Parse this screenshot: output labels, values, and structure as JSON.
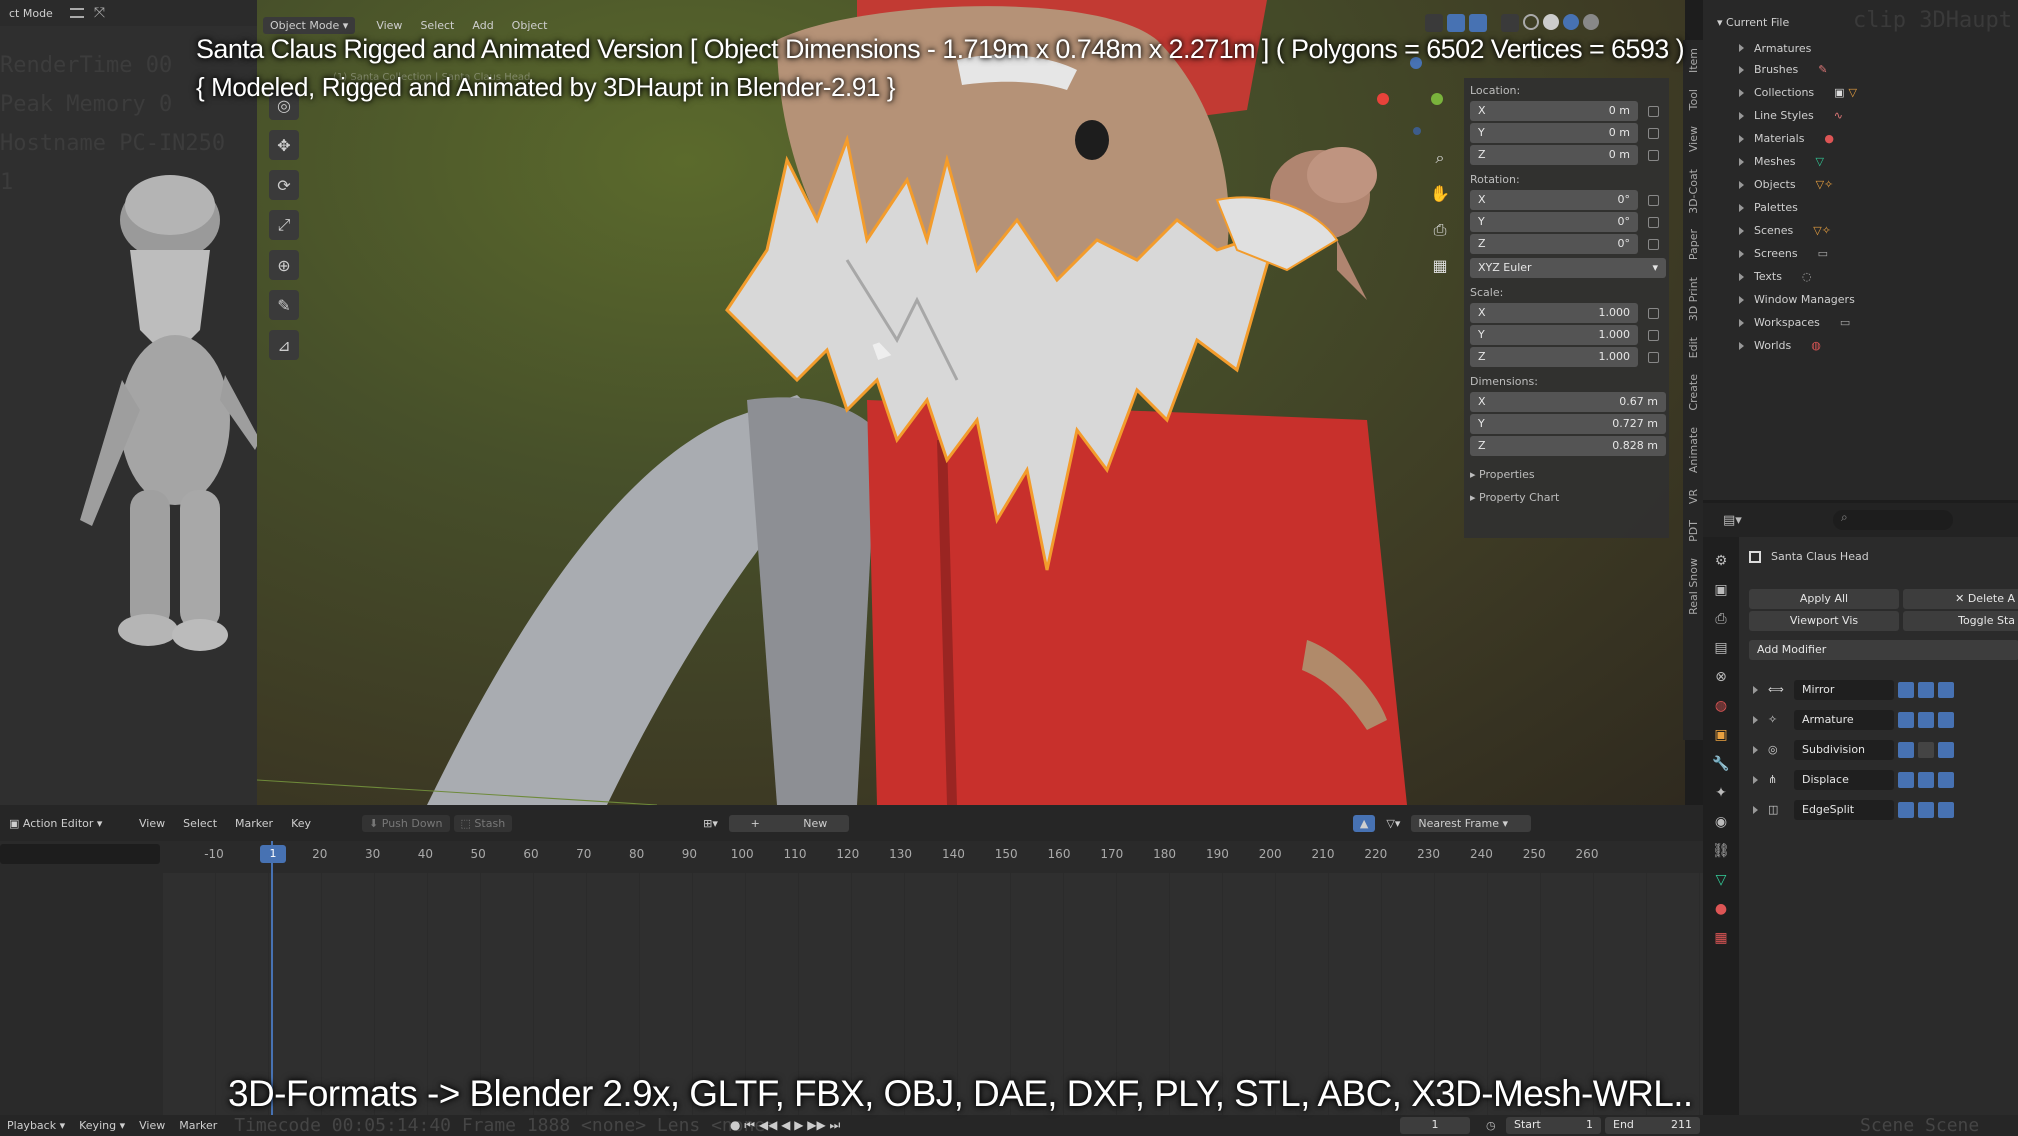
{
  "overlay": {
    "title_line1": "Santa Claus Rigged and Animated Version [ Object Dimensions -  1.719m x 0.748m x 2.271m ] ( Polygons = 6502  Vertices = 6593 )",
    "title_line2": "{ Modeled, Rigged and Animated by 3DHaupt in Blender-2.91 }",
    "formats": "3D-Formats -> Blender 2.9x, GLTF, FBX, OBJ, DAE, DXF, PLY, STL, ABC, X3D-Mesh-WRL.."
  },
  "left_panel": {
    "mode_label": "ct Mode",
    "stats": [
      "RenderTime 00",
      "Peak Memory 0",
      "Hostname PC-IN250",
      "1"
    ]
  },
  "viewport_header": {
    "mode": "Object Mode",
    "menus": [
      "View",
      "Select",
      "Add",
      "Object"
    ],
    "faint_label": "(1) Santa Collection | Santa Claus Head"
  },
  "n_panel": {
    "location_label": "Location:",
    "location": [
      {
        "axis": "X",
        "value": "0 m"
      },
      {
        "axis": "Y",
        "value": "0 m"
      },
      {
        "axis": "Z",
        "value": "0 m"
      }
    ],
    "rotation_label": "Rotation:",
    "rotation": [
      {
        "axis": "X",
        "value": "0°"
      },
      {
        "axis": "Y",
        "value": "0°"
      },
      {
        "axis": "Z",
        "value": "0°"
      }
    ],
    "rotation_mode": "XYZ Euler",
    "scale_label": "Scale:",
    "scale": [
      {
        "axis": "X",
        "value": "1.000"
      },
      {
        "axis": "Y",
        "value": "1.000"
      },
      {
        "axis": "Z",
        "value": "1.000"
      }
    ],
    "dimensions_label": "Dimensions:",
    "dimensions": [
      {
        "axis": "X",
        "value": "0.67 m"
      },
      {
        "axis": "Y",
        "value": "0.727 m"
      },
      {
        "axis": "Z",
        "value": "0.828 m"
      }
    ],
    "sections": [
      "Properties",
      "Property Chart"
    ],
    "tabs": [
      "Item",
      "Tool",
      "View",
      "3D-Coat",
      "Paper",
      "3D Print",
      "Edit",
      "Create",
      "Animate",
      "VR",
      "PDT",
      "Real Snow"
    ]
  },
  "outliner": {
    "header": "Current File",
    "faint_right": "clip 3DHaupt",
    "items": [
      "Armatures",
      "Brushes",
      "Collections",
      "Line Styles",
      "Materials",
      "Meshes",
      "Objects",
      "Palettes",
      "Scenes",
      "Screens",
      "Texts",
      "Window Managers",
      "Workspaces",
      "Worlds"
    ]
  },
  "properties": {
    "object_name": "Santa Claus Head",
    "apply_all": "Apply All",
    "delete_all": "Delete A",
    "viewport_vis": "Viewport Vis",
    "toggle_stack": "Toggle Sta",
    "add_modifier": "Add Modifier",
    "modifiers": [
      "Mirror",
      "Armature",
      "Subdivision",
      "Displace",
      "EdgeSplit"
    ]
  },
  "timeline_header": {
    "editor": "Action Editor",
    "menus": [
      "View",
      "Select",
      "Marker",
      "Key"
    ],
    "push_down": "Push Down",
    "stash": "Stash",
    "new": "New",
    "snap": "Nearest Frame"
  },
  "timeline": {
    "current_frame": "1",
    "ticks": [
      "-10",
      "10",
      "20",
      "30",
      "40",
      "50",
      "60",
      "70",
      "80",
      "90",
      "100",
      "110",
      "120",
      "130",
      "140",
      "150",
      "160",
      "170",
      "180",
      "190",
      "200",
      "210",
      "220",
      "230",
      "240",
      "250",
      "260"
    ]
  },
  "status_bar": {
    "items": [
      "Playback",
      "Keying",
      "View",
      "Marker"
    ],
    "faint": "Timecode 00:05:14:40    Frame 1888    <none>    Lens <none>",
    "frame": "1",
    "start_label": "Start",
    "start": "1",
    "end_label": "End",
    "end": "211",
    "faint_right": "Scene  Scene"
  },
  "colors": {
    "accent": "#4772b3",
    "selection": "#f39c2c",
    "santa_red": "#c8302c"
  }
}
